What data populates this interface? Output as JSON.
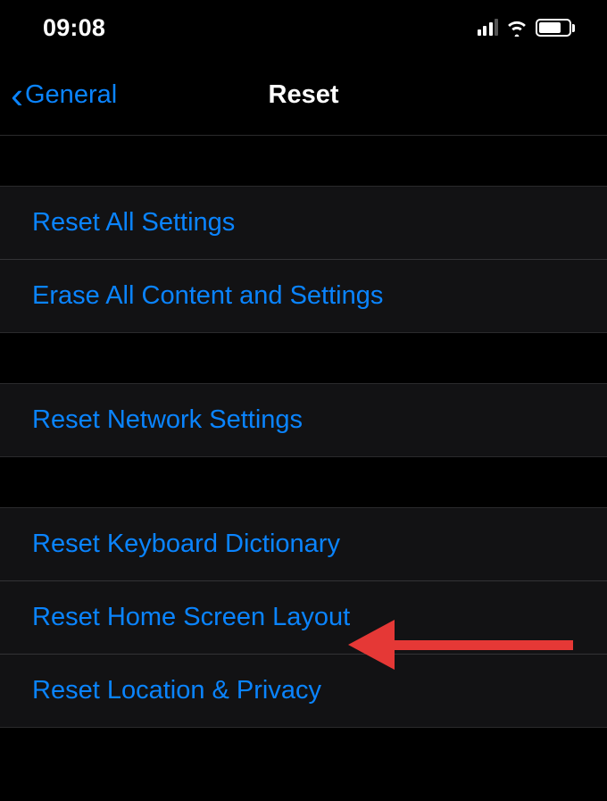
{
  "statusBar": {
    "time": "09:08"
  },
  "nav": {
    "backLabel": "General",
    "title": "Reset"
  },
  "groups": [
    {
      "items": [
        {
          "label": "Reset All Settings",
          "name": "reset-all-settings-cell"
        },
        {
          "label": "Erase All Content and Settings",
          "name": "erase-all-content-cell"
        }
      ]
    },
    {
      "items": [
        {
          "label": "Reset Network Settings",
          "name": "reset-network-settings-cell"
        }
      ]
    },
    {
      "items": [
        {
          "label": "Reset Keyboard Dictionary",
          "name": "reset-keyboard-dictionary-cell"
        },
        {
          "label": "Reset Home Screen Layout",
          "name": "reset-home-screen-layout-cell"
        },
        {
          "label": "Reset Location & Privacy",
          "name": "reset-location-privacy-cell"
        }
      ]
    }
  ]
}
